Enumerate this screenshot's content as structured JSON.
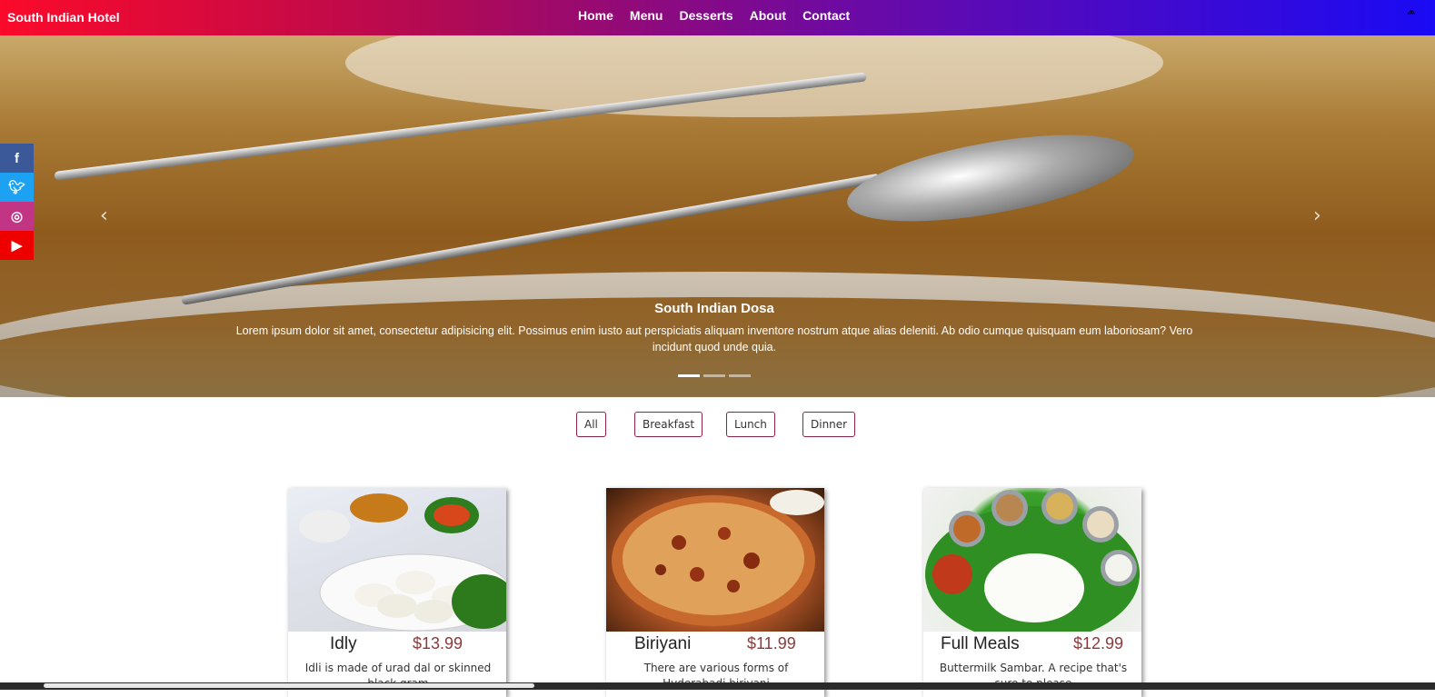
{
  "navbar": {
    "brand": "South Indian Hotel",
    "links": [
      "Home",
      "Menu",
      "Desserts",
      "About",
      "Contact"
    ],
    "logo_icon": "logo-icon"
  },
  "carousel": {
    "caption_title": "South Indian Dosa",
    "caption_text": "Lorem ipsum dolor sit amet, consectetur adipisicing elit. Possimus enim iusto aut perspiciatis aliquam inventore nostrum atque alias deleniti. Ab odio cumque quisquam eum laboriosam? Vero incidunt quod unde quia.",
    "prev_icon": "chevron-left-icon",
    "next_icon": "chevron-right-icon",
    "slide_count": 3,
    "active_slide": 1
  },
  "social": [
    {
      "name": "facebook",
      "glyph": "f",
      "color": "#3b5998"
    },
    {
      "name": "twitter",
      "glyph": "t",
      "color": "#1da1f2"
    },
    {
      "name": "instagram",
      "glyph": "◎",
      "color": "#c13584"
    },
    {
      "name": "youtube",
      "glyph": "▶",
      "color": "#ee0000"
    }
  ],
  "filters": [
    "All",
    "Breakfast",
    "Lunch",
    "Dinner"
  ],
  "menu": [
    {
      "name": "Idly",
      "price": "$13.99",
      "desc": "Idli is made of urad dal or skinned black gram"
    },
    {
      "name": "Biriyani",
      "price": "$11.99",
      "desc": "There are various forms of Hyderabadi biriyani"
    },
    {
      "name": "Full Meals",
      "price": "$12.99",
      "desc": "Buttermilk Sambar. A recipe that's sure to please"
    }
  ],
  "colors": {
    "nav_gradient_start": "#fb0a2a",
    "nav_gradient_end": "#1a0af5",
    "filter_border": "#8b2248",
    "price": "#8b3a3a"
  }
}
